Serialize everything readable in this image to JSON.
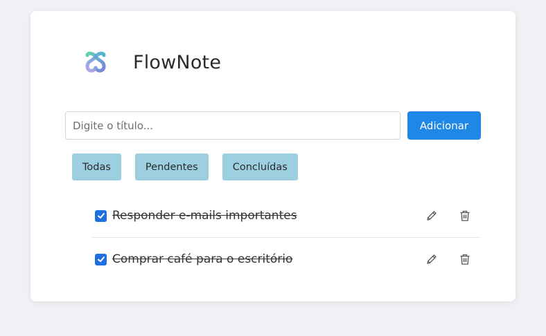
{
  "app": {
    "title": "FlowNote",
    "logo_icon": "flownote-logo-icon"
  },
  "form": {
    "title_placeholder": "Digite o título...",
    "title_value": "",
    "add_label": "Adicionar"
  },
  "filters": [
    {
      "label": "Todas"
    },
    {
      "label": "Pendentes"
    },
    {
      "label": "Concluídas"
    }
  ],
  "todos": [
    {
      "text": "Responder e-mails importantes",
      "completed": true,
      "edit_icon": "pencil-icon",
      "delete_icon": "trash-icon"
    },
    {
      "text": "Comprar café para o escritório",
      "completed": true,
      "edit_icon": "pencil-icon",
      "delete_icon": "trash-icon"
    }
  ],
  "colors": {
    "background": "#f0f1f5",
    "accent": "#1f87e5",
    "filter_bg": "#9ccfe0",
    "checkbox": "#1f6fe0"
  }
}
